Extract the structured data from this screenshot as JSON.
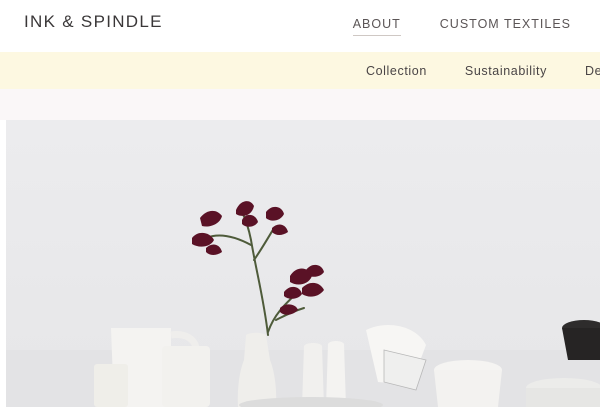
{
  "brand": {
    "name": "INK & SPINDLE"
  },
  "main_nav": {
    "items": [
      {
        "label": "ABOUT",
        "active": true
      },
      {
        "label": "CUSTOM TEXTILES",
        "active": false
      }
    ]
  },
  "sub_nav": {
    "items": [
      "Collection",
      "Sustainability",
      "Des"
    ]
  },
  "colors": {
    "subnav_bg": "#fdf8e1",
    "hero_bg": "#eaeaec",
    "flower": "#5a1226"
  }
}
